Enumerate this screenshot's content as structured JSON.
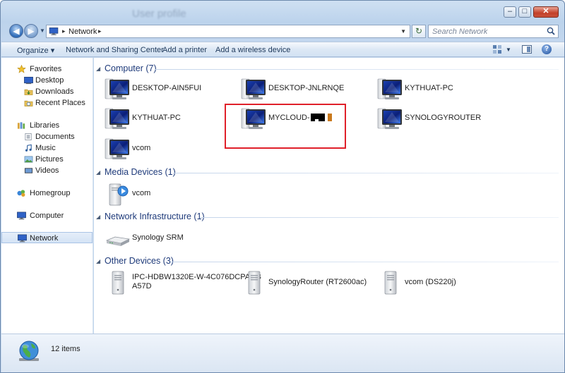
{
  "window": {
    "title": "User profile"
  },
  "window_controls": {
    "minimize": "–",
    "maximize": "□",
    "close": "✕"
  },
  "address": {
    "path": "Network",
    "search_placeholder": "Search Network"
  },
  "toolbar": {
    "organize": "Organize ▾",
    "network_sharing": "Network and Sharing Center",
    "add_printer": "Add a printer",
    "add_wireless": "Add a wireless device"
  },
  "nav": {
    "favorites": "Favorites",
    "desktop": "Desktop",
    "downloads": "Downloads",
    "recent": "Recent Places",
    "libraries": "Libraries",
    "documents": "Documents",
    "music": "Music",
    "pictures": "Pictures",
    "videos": "Videos",
    "homegroup": "Homegroup",
    "computer": "Computer",
    "network": "Network"
  },
  "groups": {
    "computer": "Computer (7)",
    "media": "Media Devices (1)",
    "infra": "Network Infrastructure (1)",
    "other": "Other Devices (3)"
  },
  "computers": [
    "DESKTOP-AIN5FUI",
    "DESKTOP-JNLRNQE",
    "KYTHUAT-PC",
    "KYTHUAT-PC",
    "MYCLOUD-",
    "SYNOLOGYROUTER",
    "vcom"
  ],
  "media_devices": [
    "vcom"
  ],
  "infrastructure": [
    "Synology SRM"
  ],
  "other_devices": {
    "ipc_line1": "IPC-HDBW1320E-W-4C076DCPAGB",
    "ipc_line2": "A57D",
    "router": "SynologyRouter (RT2600ac)",
    "nas": "vcom (DS220j)"
  },
  "details": {
    "count": "12 items"
  },
  "icons": {
    "back": "back-arrow-icon",
    "forward": "forward-arrow-icon",
    "refresh": "refresh-icon",
    "search": "search-icon",
    "help": "help-icon",
    "computer": "monitor-icon",
    "media": "media-server-icon",
    "router": "router-icon",
    "device": "tower-device-icon",
    "network": "globe-icon"
  },
  "colors": {
    "highlight": "#e0202a",
    "group_header": "#1e3a7a"
  }
}
